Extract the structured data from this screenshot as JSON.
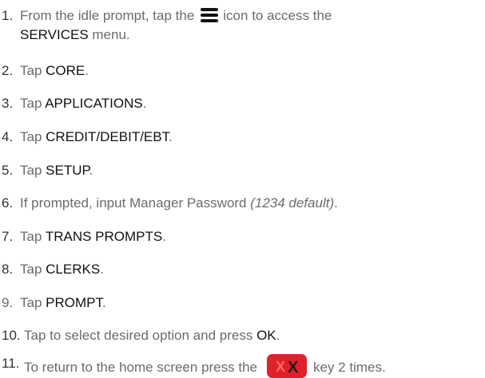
{
  "colors": {
    "text": "#6b6b6b",
    "keyword": "#111111",
    "number": "#333333",
    "cancel_key_fill": "#e0202a",
    "cancel_key_x_light": "#ff6a6a",
    "cancel_key_x_dark": "#1a1a1a"
  },
  "icons": {
    "menu": "menu-lines-icon",
    "cancel": "cancel-key-icon"
  },
  "steps": [
    {
      "num": "1.",
      "pre": "From the idle prompt, tap the",
      "post": "icon to access the",
      "kw": "SERVICES",
      "tail": " menu."
    },
    {
      "num": "2.",
      "pre": "Tap ",
      "kw": "CORE",
      "tail": "."
    },
    {
      "num": "3.",
      "pre": "Tap ",
      "kw": "APPLICATIONS",
      "tail": "."
    },
    {
      "num": "4.",
      "pre": "Tap ",
      "kw": "CREDIT/DEBIT/EBT",
      "tail": "."
    },
    {
      "num": "5.",
      "pre": "Tap ",
      "kw": "SETUP",
      "tail": "."
    },
    {
      "num": "6.",
      "pre": "If prompted, input Manager Password ",
      "em": "(1234 default)",
      "tail": "."
    },
    {
      "num": "7.",
      "pre": "Tap ",
      "kw": "TRANS PROMPTS",
      "tail": "."
    },
    {
      "num": "8.",
      "pre": "Tap ",
      "kw": "CLERKS",
      "tail": "."
    },
    {
      "num": "9.",
      "pre": "Tap ",
      "kw": "PROMPT",
      "tail": "."
    },
    {
      "num": "10.",
      "pre": "Tap to select desired option and press ",
      "kw": "OK",
      "tail": "."
    },
    {
      "num": "11.",
      "pre": "To return to the home screen press the",
      "post": "key 2 times."
    }
  ]
}
